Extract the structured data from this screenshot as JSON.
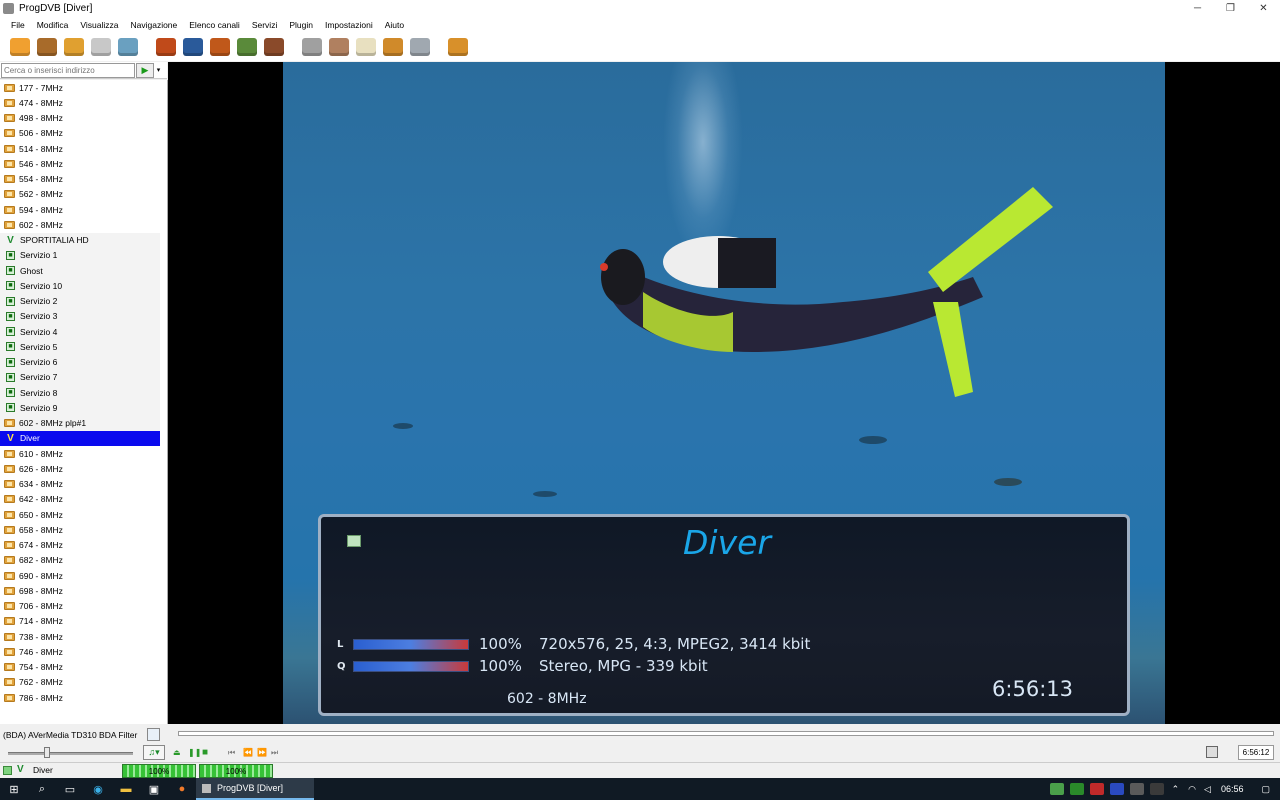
{
  "window": {
    "title": "ProgDVB [Diver]",
    "controls": {
      "minimize": "─",
      "restore": "❐",
      "close": "✕"
    }
  },
  "menu": [
    "File",
    "Modifica",
    "Visualizza",
    "Navigazione",
    "Elenco canali",
    "Servizi",
    "Plugin",
    "Impostazioni",
    "Aiuto"
  ],
  "toolbar": {
    "icons": [
      {
        "name": "open-folder-icon",
        "color": "#f0a030"
      },
      {
        "name": "film-icon",
        "color": "#a86b2a"
      },
      {
        "name": "back-arrow-icon",
        "color": "#e0a030"
      },
      {
        "name": "forward-arrow-icon",
        "color": "#c8c8c8"
      },
      {
        "name": "search-magnifier-icon",
        "color": "#6aa0c0"
      },
      {
        "name": "monitor-red-icon",
        "color": "#c04a1a"
      },
      {
        "name": "monitor-blue-icon",
        "color": "#2a5a9a"
      },
      {
        "name": "3d-icon",
        "color": "#c0581a"
      },
      {
        "name": "monitor-landscape-icon",
        "color": "#5a8a3a"
      },
      {
        "name": "grid-mosaic-icon",
        "color": "#8a4a2a"
      },
      {
        "name": "subs-icon",
        "color": "#a0a0a0"
      },
      {
        "name": "disc-record-icon",
        "color": "#b08060"
      },
      {
        "name": "notes-icon",
        "color": "#e8e0c0"
      },
      {
        "name": "clock-icon",
        "color": "#d08a2a"
      },
      {
        "name": "panel-icon",
        "color": "#a0a8b0"
      },
      {
        "name": "settings-gear-icon",
        "color": "#d8902a"
      }
    ]
  },
  "search": {
    "placeholder": "Cerca o inserisci indirizzo",
    "go_label": "▶",
    "dropdown_label": "▾"
  },
  "channels": [
    {
      "label": "177 - 7MHz",
      "type": "folder"
    },
    {
      "label": "474 - 8MHz",
      "type": "folder"
    },
    {
      "label": "498 - 8MHz",
      "type": "folder"
    },
    {
      "label": "506 - 8MHz",
      "type": "folder"
    },
    {
      "label": "514 - 8MHz",
      "type": "folder"
    },
    {
      "label": "546 - 8MHz",
      "type": "folder"
    },
    {
      "label": "554 - 8MHz",
      "type": "folder"
    },
    {
      "label": "562 - 8MHz",
      "type": "folder"
    },
    {
      "label": "594 - 8MHz",
      "type": "folder"
    },
    {
      "label": "602 - 8MHz",
      "type": "folder"
    },
    {
      "label": "SPORTITALIA HD",
      "type": "v"
    },
    {
      "label": "Servizio 1",
      "type": "tv"
    },
    {
      "label": "Ghost",
      "type": "tv"
    },
    {
      "label": "Servizio 10",
      "type": "tv"
    },
    {
      "label": "Servizio 2",
      "type": "tv"
    },
    {
      "label": "Servizio 3",
      "type": "tv"
    },
    {
      "label": "Servizio 4",
      "type": "tv"
    },
    {
      "label": "Servizio 5",
      "type": "tv"
    },
    {
      "label": "Servizio 6",
      "type": "tv"
    },
    {
      "label": "Servizio 7",
      "type": "tv"
    },
    {
      "label": "Servizio 8",
      "type": "tv"
    },
    {
      "label": "Servizio 9",
      "type": "tv"
    },
    {
      "label": "602 - 8MHz plp#1",
      "type": "folder",
      "light": true
    },
    {
      "label": "Diver",
      "type": "v",
      "selected": true
    },
    {
      "label": "610 - 8MHz",
      "type": "folder"
    },
    {
      "label": "626 - 8MHz",
      "type": "folder"
    },
    {
      "label": "634 - 8MHz",
      "type": "folder"
    },
    {
      "label": "642 - 8MHz",
      "type": "folder"
    },
    {
      "label": "650 - 8MHz",
      "type": "folder"
    },
    {
      "label": "658 - 8MHz",
      "type": "folder"
    },
    {
      "label": "674 - 8MHz",
      "type": "folder"
    },
    {
      "label": "682 - 8MHz",
      "type": "folder"
    },
    {
      "label": "690 - 8MHz",
      "type": "folder"
    },
    {
      "label": "698 - 8MHz",
      "type": "folder"
    },
    {
      "label": "706 - 8MHz",
      "type": "folder"
    },
    {
      "label": "714 - 8MHz",
      "type": "folder"
    },
    {
      "label": "738 - 8MHz",
      "type": "folder"
    },
    {
      "label": "746 - 8MHz",
      "type": "folder"
    },
    {
      "label": "754 - 8MHz",
      "type": "folder"
    },
    {
      "label": "762 - 8MHz",
      "type": "folder"
    },
    {
      "label": "786 - 8MHz",
      "type": "folder"
    }
  ],
  "osd": {
    "channel_name": "Diver",
    "video": {
      "tag": "L",
      "level": 1.0,
      "percent": "100%",
      "info": "720x576, 25, 4:3, MPEG2, 3414 kbit"
    },
    "audio": {
      "tag": "Q",
      "level": 1.0,
      "percent": "100%",
      "info": "Stereo, MPG - 339 kbit"
    },
    "frequency": "602 - 8MHz",
    "time": "6:56:13",
    "colors": {
      "title": "#1aa6e8",
      "frame": "#9fb0c4"
    }
  },
  "device": {
    "label": "(BDA) AVerMedia TD310 BDA Filter"
  },
  "player": {
    "volume_level": 0.3,
    "audio_button": "♫▾",
    "eject": "⏏",
    "pause": "❚❚",
    "stop": "■",
    "prev": "⏮",
    "rewind": "⏪",
    "fast_forward": "⏩",
    "next": "⏭",
    "clock": "6:56:12"
  },
  "status": {
    "channel": "Diver",
    "signal_level_text": "100%",
    "signal_level": 1.0,
    "quality_text": "100%",
    "quality_level": 1.0
  },
  "taskbar": {
    "start_icon": "windows-start-icon",
    "active_app": "ProgDVB [Diver]",
    "clock": "06:56",
    "items": [
      "search-icon",
      "task-view-icon",
      "edge-icon",
      "file-explorer-icon",
      "store-icon",
      "firefox-icon"
    ]
  }
}
